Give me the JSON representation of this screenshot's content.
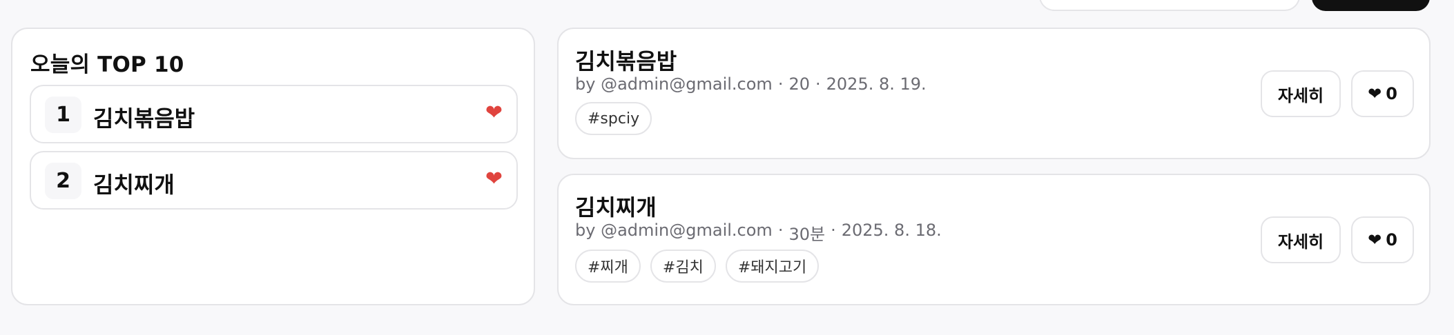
{
  "header": {
    "search_placeholder": "",
    "button_label": ""
  },
  "top10": {
    "title": "오늘의 TOP 10",
    "items": [
      {
        "rank": "1",
        "name": "김치볶음밥",
        "icon": "heart-icon"
      },
      {
        "rank": "2",
        "name": "김치찌개",
        "icon": "heart-icon"
      }
    ]
  },
  "posts": [
    {
      "title": "김치볶음밥",
      "author": "by @admin@gmail.com",
      "time": "20",
      "date": "2025. 8. 19.",
      "tags": [
        "#spciy"
      ],
      "detail_label": "자세히",
      "likes": "0"
    },
    {
      "title": "김치찌개",
      "author": "by @admin@gmail.com",
      "time": "30분",
      "date": "2025. 8. 18.",
      "tags": [
        "#찌개",
        "#김치",
        "#돼지고기"
      ],
      "detail_label": "자세히",
      "likes": "0"
    }
  ],
  "colors": {
    "heart": "#e0443e",
    "border": "#e4e4e7",
    "background": "#f8f8fa"
  }
}
